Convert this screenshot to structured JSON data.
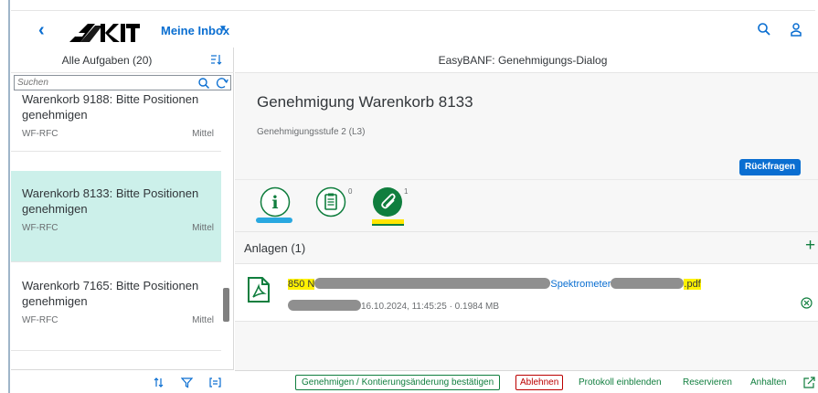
{
  "shell": {
    "back_label": "‹",
    "inbox_title": "Meine Inbox",
    "inbox_caret": "▼"
  },
  "master": {
    "title": "Alle Aufgaben (20)",
    "search_placeholder": "Suchen",
    "items": [
      {
        "title": "Warenkorb 9188: Bitte Positionen genehmigen",
        "sub": "WF-RFC",
        "prio": "Mittel",
        "selected": false
      },
      {
        "title": "Warenkorb 8133: Bitte Positionen genehmigen",
        "sub": "WF-RFC",
        "prio": "Mittel",
        "selected": true
      },
      {
        "title": "Warenkorb 7165: Bitte Positionen genehmigen",
        "sub": "WF-RFC",
        "prio": "Mittel",
        "selected": false
      }
    ]
  },
  "detail": {
    "header": "EasyBANF: Genehmigungs-Dialog",
    "object_title": "Genehmigung Warenkorb 8133",
    "object_subtitle": "Genehmigungsstufe 2 (L3)",
    "rueckfragen_label": "Rückfragen",
    "tabs": {
      "info_glyph": "i",
      "notes_count": "0",
      "attachments_count": "1"
    },
    "attachments": {
      "heading": "Anlagen (1)",
      "plus": "+",
      "file_prefix": "850 N",
      "file_middle": "Spektrometer",
      "file_ext": ".pdf",
      "meta": "16.10.2024, 11:45:25 · 0.1984 MB"
    }
  },
  "footer": {
    "approve_label": "Genehmigen / Kontierungsänderung bestätigen",
    "reject_label": "Ablehnen",
    "protocol_label": "Protokoll einblenden",
    "reserve_label": "Reservieren",
    "hold_label": "Anhalten"
  },
  "colors": {
    "accent": "#0a6ed1",
    "positive": "#107e3e",
    "negative": "#bb0000",
    "selected_row": "#ccf0ea",
    "highlight": "#fff200",
    "underline_info": "#29a8e0",
    "underline_attach": "#ffe500"
  },
  "icons": {
    "search": "search-icon",
    "user": "user-icon",
    "sort": "sort-icon",
    "refresh": "refresh-icon",
    "info": "info-icon",
    "notes": "notes-icon",
    "attachment": "paperclip-icon",
    "pdf": "pdf-file-icon",
    "delete": "delete-icon",
    "filter": "filter-icon",
    "group": "group-icon",
    "share": "share-icon"
  }
}
